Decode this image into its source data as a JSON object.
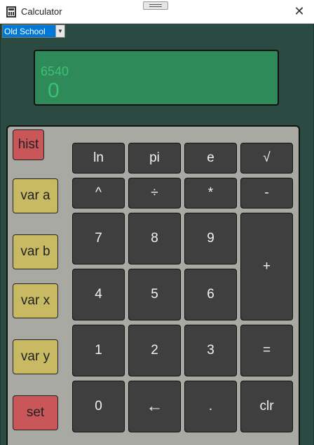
{
  "window": {
    "title": "Calculator",
    "close_glyph": "✕"
  },
  "mode": {
    "selected": "Old School",
    "arrow": "▼"
  },
  "display": {
    "history": "6540",
    "current": "0"
  },
  "side_buttons": {
    "hist": "hist",
    "var_a": "var a",
    "var_b": "var b",
    "var_x": "var x",
    "var_y": "var y",
    "set": "set"
  },
  "keys": {
    "ln": "ln",
    "pi": "pi",
    "e": "e",
    "sqrt": "√",
    "pow": "^",
    "divide": "÷",
    "multiply": "*",
    "minus": "-",
    "seven": "7",
    "eight": "8",
    "nine": "9",
    "plus": "+",
    "four": "4",
    "five": "5",
    "six": "6",
    "one": "1",
    "two": "2",
    "three": "3",
    "equals": "=",
    "zero": "0",
    "backspace": "←",
    "dot": ".",
    "clear": "clr"
  },
  "colors": {
    "window_bg": "#2b4a42",
    "display_bg": "#2e8a58",
    "display_text": "#3fbf72",
    "keypad_bg": "#a9a9a4",
    "key_bg": "#3f3f3f",
    "side_red": "#c9575a",
    "side_yellow": "#c8ba62",
    "select_highlight": "#0078d7"
  }
}
